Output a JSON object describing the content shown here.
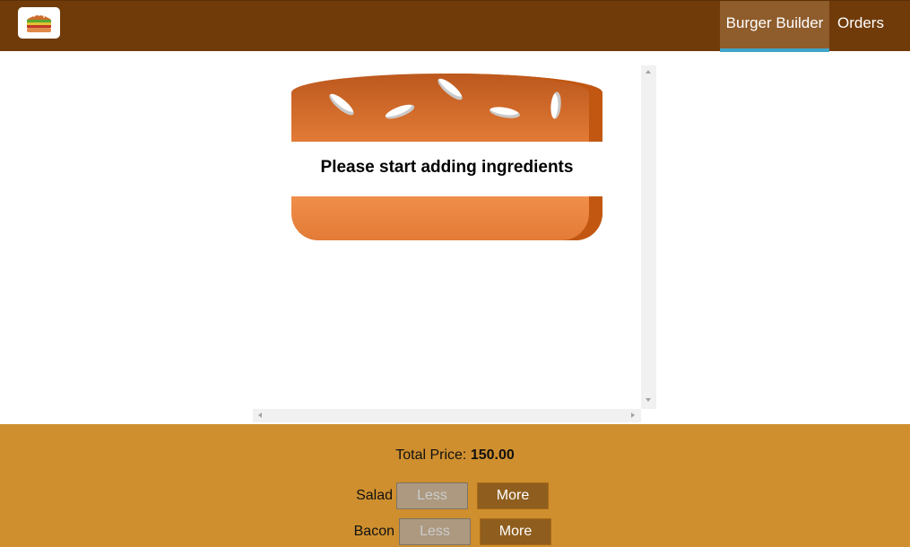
{
  "toolbar": {
    "logo_icon": "burger-logo-icon",
    "nav": {
      "burger_builder": "Burger Builder",
      "orders": "Orders"
    }
  },
  "burger": {
    "message": "Please start adding ingredients"
  },
  "controls": {
    "price_label": "Total Price:",
    "price_value": "150.00",
    "ingredients": [
      {
        "label": "Salad",
        "less": "Less",
        "more": "More",
        "less_disabled": true
      },
      {
        "label": "Bacon",
        "less": "Less",
        "more": "More",
        "less_disabled": true
      }
    ]
  },
  "colors": {
    "toolbar": "#703b09",
    "active_nav": "#8f5c2c",
    "active_indicator": "#40a4c8",
    "controls_bg": "#cf8f2e",
    "more_button": "#8f5e1e",
    "less_button_disabled": "#ac9980",
    "bread": "#e27b36"
  }
}
